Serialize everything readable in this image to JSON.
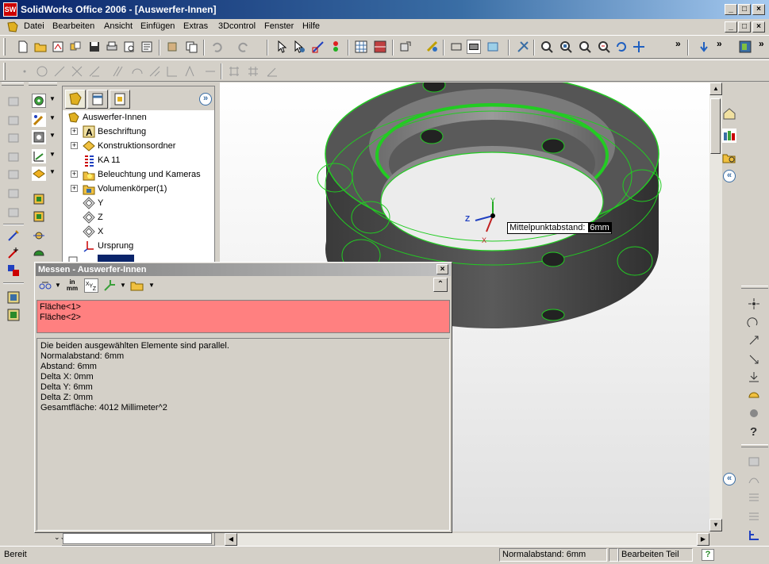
{
  "window": {
    "title": "SolidWorks Office 2006 - [Auswerfer-Innen]",
    "app_icon_text": "SW",
    "controls": [
      "_",
      "□",
      "×"
    ],
    "doc_controls": [
      "_",
      "□",
      "×"
    ]
  },
  "menu": [
    "Datei",
    "Bearbeiten",
    "Ansicht",
    "Einfügen",
    "Extras",
    "3Dcontrol",
    "Fenster",
    "Hilfe"
  ],
  "tree": {
    "items": [
      {
        "label": "Auswerfer-Innen",
        "icon": "part-icon",
        "expander": ""
      },
      {
        "label": "Beschriftung",
        "icon": "annotation-icon",
        "expander": "+"
      },
      {
        "label": "Konstruktionsordner",
        "icon": "design-folder-icon",
        "expander": "+"
      },
      {
        "label": "KA 11",
        "icon": "material-icon",
        "expander": ""
      },
      {
        "label": "Beleuchtung und Kameras",
        "icon": "lights-folder-icon",
        "expander": "+"
      },
      {
        "label": "Volumenkörper(1)",
        "icon": "solid-bodies-icon",
        "expander": "+"
      },
      {
        "label": "Y",
        "icon": "plane-icon",
        "expander": ""
      },
      {
        "label": "Z",
        "icon": "plane-icon",
        "expander": ""
      },
      {
        "label": "X",
        "icon": "plane-icon",
        "expander": ""
      },
      {
        "label": "Ursprung",
        "icon": "origin-icon",
        "expander": ""
      }
    ]
  },
  "measure": {
    "title": "Messen - Auswerfer-Innen",
    "units_label_top": "in",
    "units_label_bottom": "mm",
    "selections": [
      "Fläche<1>",
      "Fläche<2>"
    ],
    "results": [
      "Die beiden ausgewählten Elemente sind parallel.",
      "Normalabstand: 6mm",
      "Abstand: 6mm",
      "Delta X: 0mm",
      "Delta Y: 6mm",
      "Delta Z: 0mm",
      "Gesamtfläche: 4012 Millimeter^2"
    ]
  },
  "viewport": {
    "callout_label": "Mittelpunktabstand:",
    "callout_value": "6mm",
    "axis_labels": {
      "x": "X",
      "y": "Y",
      "z": "Z"
    }
  },
  "status": {
    "left": "Bereit",
    "measure": "Normalabstand: 6mm",
    "mode": "Bearbeiten Teil",
    "help": "?"
  },
  "colors": {
    "titlebar": "#0a246a",
    "selection_highlight": "#ff8080",
    "edge_green": "#22cc22",
    "part_gray": "#4a4a4a"
  }
}
